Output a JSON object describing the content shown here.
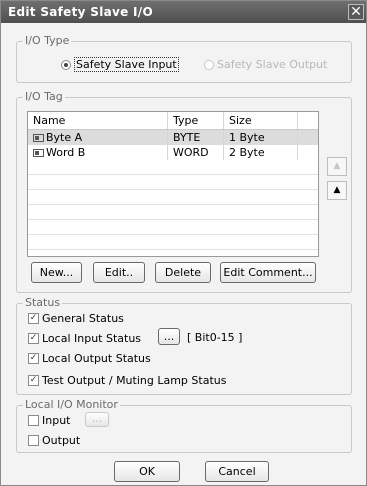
{
  "window": {
    "title": "Edit Safety Slave I/O",
    "close_glyph": "✕"
  },
  "io_type": {
    "legend": "I/O Type",
    "input_label": "Safety Slave Input",
    "output_label": "Safety Slave Output"
  },
  "io_tag": {
    "legend": "I/O Tag",
    "columns": [
      "Name",
      "Type",
      "Size"
    ],
    "rows": [
      {
        "name": "Byte A",
        "type": "BYTE",
        "size": "1 Byte"
      },
      {
        "name": "Word B",
        "type": "WORD",
        "size": "2 Byte"
      }
    ],
    "move_up_glyph": "▲",
    "move_down_glyph": "▲",
    "buttons": {
      "new": "New...",
      "edit": "Edit..",
      "delete": "Delete",
      "edit_comment": "Edit Comment..."
    }
  },
  "status": {
    "legend": "Status",
    "general": "General Status",
    "local_input": "Local Input Status",
    "bit_button": "...",
    "bit_range": "[ Bit0-15 ]",
    "local_output": "Local Output Status",
    "test_output": "Test Output / Muting Lamp Status",
    "check_glyph": "✓"
  },
  "monitor": {
    "legend": "Local I/O Monitor",
    "input": "Input",
    "input_button": "...",
    "output": "Output"
  },
  "footer": {
    "ok": "OK",
    "cancel": "Cancel"
  }
}
